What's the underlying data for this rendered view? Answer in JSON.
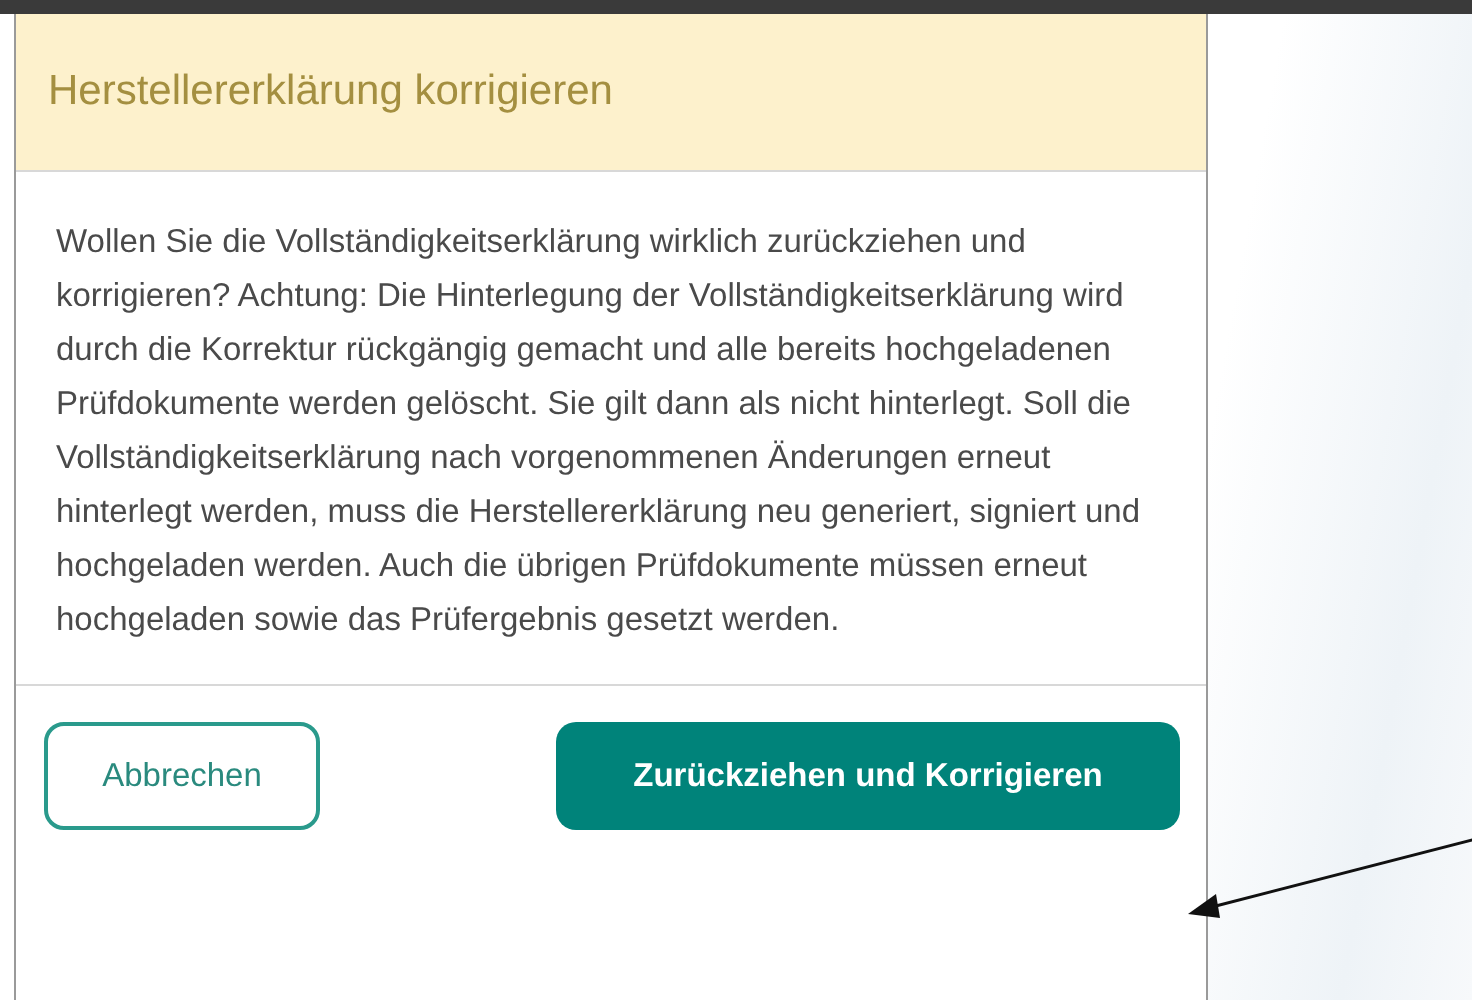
{
  "dialog": {
    "title": "Herstellererklärung korrigieren",
    "message": "Wollen Sie die Vollständigkeitserklärung wirklich zurückziehen und korrigieren? Achtung: Die Hinterlegung der Vollständigkeitserklärung wird durch die Korrektur rückgängig gemacht und alle bereits hochgeladenen Prüfdokumente werden gelöscht. Sie gilt dann als nicht hinterlegt. Soll die Vollständigkeitserklärung nach vorgenommenen Änderungen erneut hinterlegt werden, muss die Herstellererklärung neu generiert, signiert und hochgeladen werden. Auch die übrigen Prüfdokumente müssen erneut hochgeladen sowie das Prüfergebnis gesetzt werden.",
    "buttons": [
      {
        "label": "Abbrechen",
        "kind": "secondary"
      },
      {
        "label": "Zurückziehen und Korrigieren",
        "kind": "primary"
      }
    ]
  }
}
